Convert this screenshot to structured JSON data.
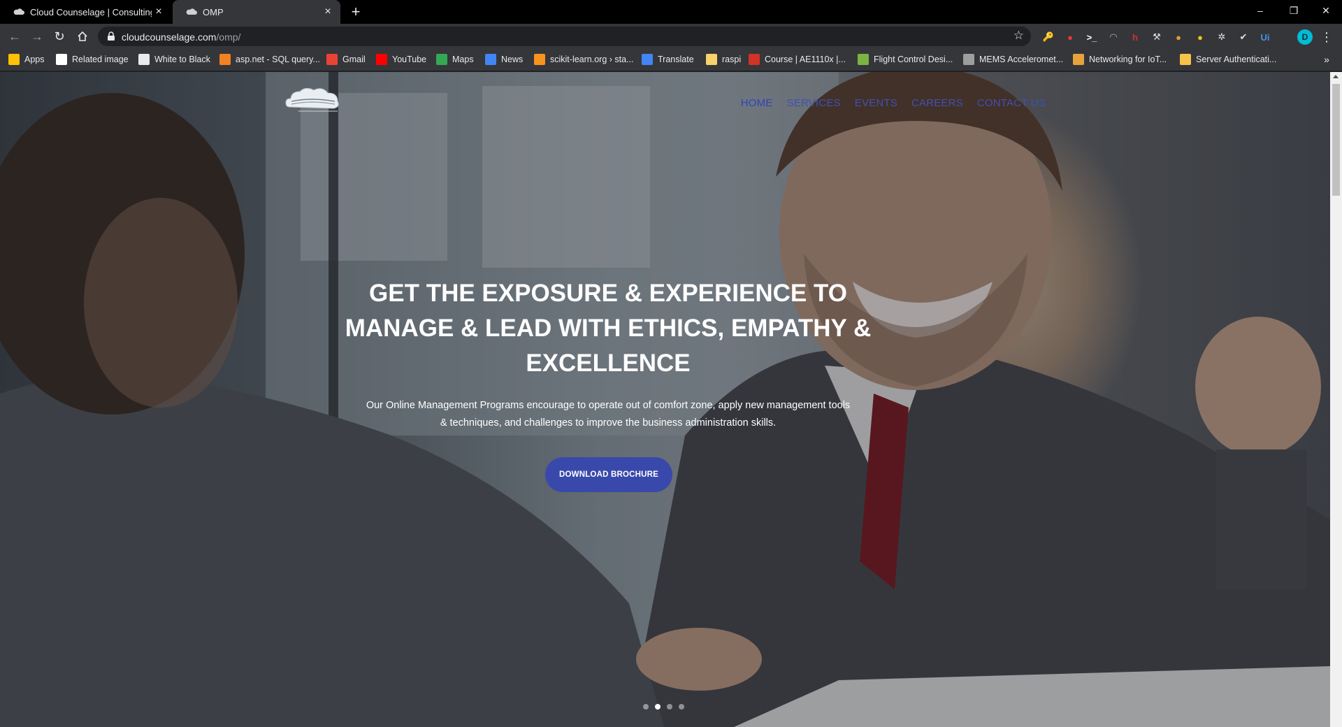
{
  "browser": {
    "tabs": [
      {
        "title": "Cloud Counselage | Consulting, A",
        "active": false
      },
      {
        "title": "OMP",
        "active": true
      }
    ],
    "new_tab_label": "+",
    "window_controls": {
      "minimize": "–",
      "restore": "❐",
      "close": "✕"
    },
    "url": {
      "domain": "cloudcounselage.com",
      "path": "/omp/"
    },
    "profile_initial": "D",
    "extensions": [
      {
        "name": "key-extension-icon",
        "glyph": "🔑",
        "color": "#f4a23c"
      },
      {
        "name": "adblock-extension-icon",
        "glyph": "●",
        "color": "#e53935"
      },
      {
        "name": "terminal-extension-icon",
        "glyph": ">_",
        "color": "#ffffff"
      },
      {
        "name": "ghost-extension-icon",
        "glyph": "◠",
        "color": "#b0b0b0"
      },
      {
        "name": "h-extension-icon",
        "glyph": "h",
        "color": "#d32f2f"
      },
      {
        "name": "wrench-extension-icon",
        "glyph": "⚒",
        "color": "#e0e0e0"
      },
      {
        "name": "cookie-extension-icon",
        "glyph": "●",
        "color": "#e69a3a"
      },
      {
        "name": "pencil-extension-icon",
        "glyph": "●",
        "color": "#f0c419"
      },
      {
        "name": "gear-extension-icon",
        "glyph": "✲",
        "color": "#e0e0e0"
      },
      {
        "name": "brush-extension-icon",
        "glyph": "✔",
        "color": "#e0e0e0"
      },
      {
        "name": "ui-extension-icon",
        "glyph": "Ui",
        "color": "#4a90e2"
      }
    ]
  },
  "bookmarks": [
    {
      "label": "Apps",
      "icon": "apps-grid-icon",
      "color": "#ffc107"
    },
    {
      "label": "Related image",
      "icon": "page-icon",
      "color": "#ffffff"
    },
    {
      "label": "White to Black",
      "icon": "globe-icon",
      "color": "#e8eaed"
    },
    {
      "label": "asp.net - SQL query...",
      "icon": "stack-icon",
      "color": "#f48024"
    },
    {
      "label": "Gmail",
      "icon": "gmail-icon",
      "color": "#ea4335"
    },
    {
      "label": "YouTube",
      "icon": "youtube-icon",
      "color": "#ff0000"
    },
    {
      "label": "Maps",
      "icon": "maps-icon",
      "color": "#34a853"
    },
    {
      "label": "News",
      "icon": "news-icon",
      "color": "#4285f4"
    },
    {
      "label": "scikit-learn.org › sta...",
      "icon": "sklearn-icon",
      "color": "#f7931e"
    },
    {
      "label": "Translate",
      "icon": "translate-icon",
      "color": "#4285f4"
    },
    {
      "label": "raspi",
      "icon": "folder-icon",
      "color": "#f6d36b"
    },
    {
      "label": "Course | AE1110x |...",
      "icon": "edx-icon",
      "color": "#d23228"
    },
    {
      "label": "Flight Control Desi...",
      "icon": "coursera-icon",
      "color": "#7cb342"
    },
    {
      "label": "MEMS Acceleromet...",
      "icon": "mems-icon",
      "color": "#9e9e9e"
    },
    {
      "label": "Networking for IoT...",
      "icon": "e-icon",
      "color": "#e6a23c"
    },
    {
      "label": "Server Authenticati...",
      "icon": "box-icon",
      "color": "#f6c24a"
    }
  ],
  "bookmarks_more": "»",
  "site": {
    "nav": [
      "HOME",
      "SERVICES",
      "EVENTS",
      "CAREERS",
      "CONTACT US"
    ],
    "hero": {
      "title": "GET THE EXPOSURE & EXPERIENCE TO MANAGE & LEAD WITH ETHICS, EMPATHY & EXCELLENCE",
      "subtitle": "Our Online Management Programs encourage to operate out of comfort zone, apply new management tools & techniques, and challenges to improve the business administration skills.",
      "cta": "DOWNLOAD BROCHURE"
    },
    "slider": {
      "count": 4,
      "active_index": 1
    }
  }
}
